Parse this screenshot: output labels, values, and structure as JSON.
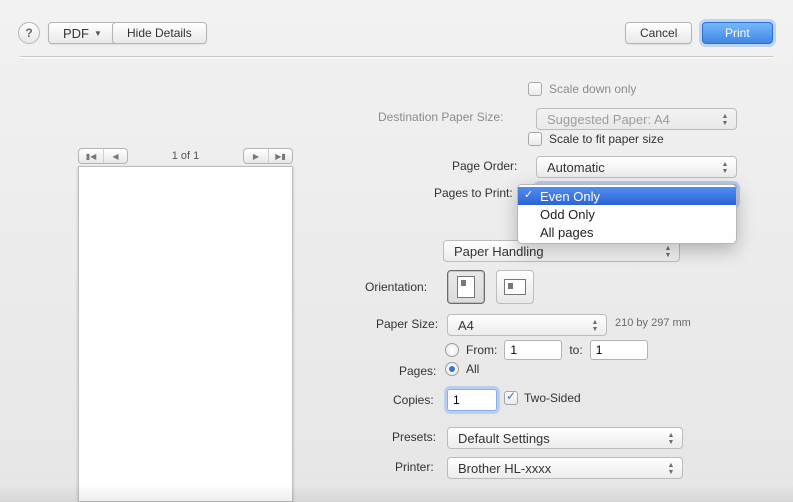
{
  "buttons": {
    "help": "?",
    "pdf": "PDF",
    "hideDetails": "Hide Details",
    "cancel": "Cancel",
    "print": "Print"
  },
  "scaleDown": {
    "label": "Scale down only",
    "checked": false
  },
  "destPaper": {
    "label": "Destination Paper Size:",
    "value": "Suggested Paper: A4"
  },
  "scaleFit": {
    "label": "Scale to fit paper size",
    "checked": false
  },
  "pageOrder": {
    "label": "Page Order:",
    "value": "Automatic"
  },
  "pagesToPrint": {
    "label": "Pages to Print:",
    "options": [
      "Even Only",
      "Odd Only",
      "All pages"
    ],
    "selected": "Even Only"
  },
  "sectionPop": {
    "value": "Paper Handling"
  },
  "orientation": {
    "label": "Orientation:"
  },
  "paperSize": {
    "label": "Paper Size:",
    "value": "A4",
    "dim": "210 by 297 mm"
  },
  "pages": {
    "label": "Pages:",
    "allLabel": "All",
    "fromLabel": "From:",
    "toLabel": "to:",
    "from": "1",
    "to": "1"
  },
  "copies": {
    "label": "Copies:",
    "value": "1",
    "twoSided": "Two-Sided",
    "twoSidedChecked": true
  },
  "presets": {
    "label": "Presets:",
    "value": "Default Settings"
  },
  "printer": {
    "label": "Printer:",
    "value": "Brother HL-xxxx"
  },
  "preview": {
    "counter": "1 of 1"
  }
}
